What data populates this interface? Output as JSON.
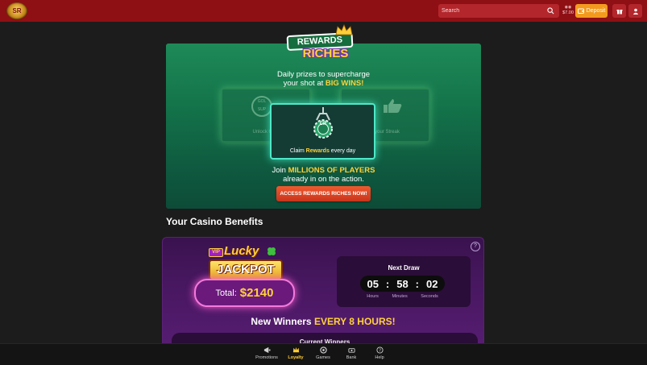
{
  "header": {
    "logo_text": "SR",
    "search_placeholder": "Search",
    "wallet_amount": "$7.00",
    "deposit_label": "Deposit"
  },
  "rewards": {
    "logo_top": "REWARDS",
    "logo_bottom": "RICHES",
    "tagline_1": "Daily prizes to supercharge",
    "tagline_2a": "your shot at ",
    "tagline_2b": "BIG WINS!",
    "left_card_text": "Unlock Ga...",
    "left_card_badge": "GOL SUP",
    "right_card_text": "...your Streak",
    "center_card_pre": "Claim ",
    "center_card_bold": "Rewards",
    "center_card_post": " every day",
    "chip_text": "CR",
    "join_a": "Join ",
    "join_b": "MILLIONS OF PLAYERS",
    "join_c": "already in on the action.",
    "cta_label": "ACCESS REWARDS RICHES NOW!"
  },
  "benefits": {
    "title": "Your Casino Benefits",
    "help": "?",
    "jackpot_vip": "VIP",
    "jackpot_lucky": "Lucky",
    "jackpot_word": "JACKPOT",
    "total_label": "Total:",
    "total_value": "$2140",
    "next_draw": "Next Draw",
    "hours": "05",
    "minutes": "58",
    "seconds": "02",
    "sep": ":",
    "hours_label": "Hours",
    "minutes_label": "Minutes",
    "seconds_label": "Seconds",
    "winners_a": "New Winners ",
    "winners_b": "EVERY 8 HOURS!",
    "current_winners": "Current Winners"
  },
  "nav": {
    "items": [
      {
        "label": "Promotions"
      },
      {
        "label": "Loyalty"
      },
      {
        "label": "Games"
      },
      {
        "label": "Bank"
      },
      {
        "label": "Help"
      }
    ]
  },
  "colors": {
    "topbar": "#8e0f14",
    "accent": "#ffd23a",
    "deposit": "#f39a1e",
    "cta": "#e04b26"
  }
}
